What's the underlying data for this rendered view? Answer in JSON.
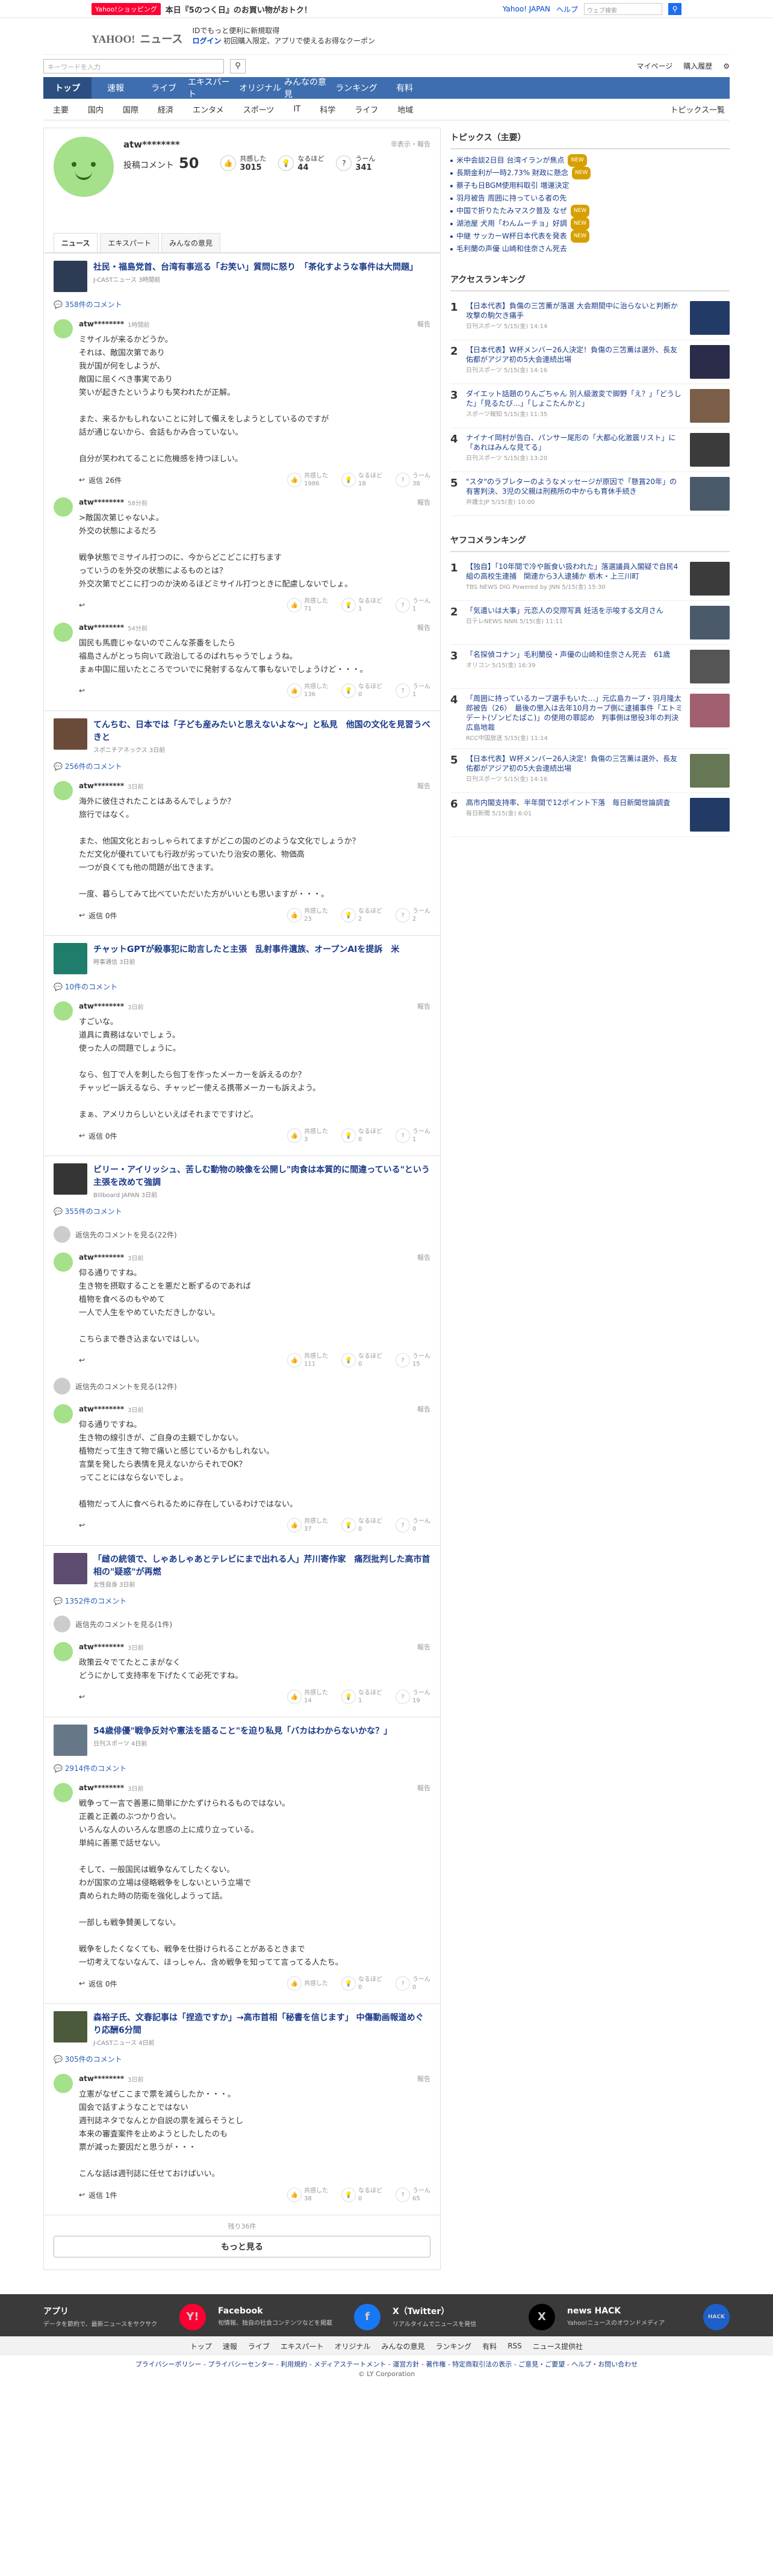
{
  "topstrip": {
    "badge": "Yahoo!ショッピング",
    "promo": "本日『5のつく日』のお買い物がおトク！",
    "right_links": [
      "Yahoo! JAPAN",
      "ヘルプ"
    ],
    "search_placeholder": "ウェブ検索"
  },
  "brand": {
    "logo": "YAHOO!",
    "sub": "ニュース",
    "promo_line1": "IDでもっと便利に新規取得",
    "promo_line2_bold": "ログイン",
    "promo_line2": "初回購入限定、アプリで使えるお得なクーポン"
  },
  "searchbar": {
    "placeholder": "キーワードを入力",
    "links": [
      "マイページ",
      "購入履歴"
    ]
  },
  "nav_main": [
    "トップ",
    "速報",
    "ライブ",
    "エキスパート",
    "オリジナル",
    "みんなの意見",
    "ランキング",
    "有料"
  ],
  "nav_sub": [
    "主要",
    "国内",
    "国際",
    "経済",
    "エンタメ",
    "スポーツ",
    "IT",
    "科学",
    "ライフ",
    "地域"
  ],
  "nav_sub_right": "トピックス一覧",
  "profile": {
    "name": "atw********",
    "hidden": "非表示・報告",
    "comments_label": "投稿コメント",
    "comments_count": "50",
    "stats": [
      {
        "label": "共感した",
        "value": "3015"
      },
      {
        "label": "なるほど",
        "value": "44"
      },
      {
        "label": "うーん",
        "value": "341"
      }
    ],
    "tabs": [
      "ニュース",
      "エキスパート",
      "みんなの意見"
    ]
  },
  "articles": [
    {
      "title": "社民・福島党首、台湾有事巡る「お笑い」質問に怒り　「茶化すような事件は大問題」",
      "source": "J-CASTニュース 3時間前",
      "count": "358件のコメント",
      "comments": [
        {
          "user": "atw********",
          "time": "1時間前",
          "text": "ミサイルが来るかどうか。\nそれは、敵国次第であり\n我が国が何をしようが、\n敵国に屈くべき事実であり\n笑いが起きたというよりも笑われたが正解。\n\nまた、来るかもしれないことに対して備えをしようとしているのですが\n話が通じないから、会話もかみ合っていない。\n\n自分が笑われてることに危機感を持つほしい。",
          "replies": "返信 26件",
          "r": [
            "1986",
            "18",
            "38"
          ]
        },
        {
          "user": "atw********",
          "time": "58分前",
          "text": ">敵国次第じゃないよ。\n外交の状態によるだろ\n\n戦争状態でミサイル打つのに、今からどこどこに打ちます\nっていうのを外交の状態によるものとは？\n外交次第でどこに打つのか決めるほどミサイル打つときに配慮しないでしょ。",
          "replies": "",
          "r": [
            "71",
            "1",
            "1"
          ]
        },
        {
          "user": "atw********",
          "time": "54分前",
          "text": "国民も馬鹿じゃないのでこんな茶番をしたら\n福島さんがとっち向いて政治してるのばれちゃうでしょうね。\nまぁ中国に屈いたところでついでに発射するなんて事もないでしょうけど・・・。",
          "replies": "",
          "r": [
            "136",
            "0",
            "1"
          ]
        }
      ]
    },
    {
      "title": "てんちむ、日本では「子ども産みたいと思えないよな〜」と私見　他国の文化を見習うべきと",
      "source": "スポニチアネックス 3日前",
      "count": "256件のコメント",
      "comments": [
        {
          "user": "atw********",
          "time": "3日前",
          "text": "海外に彼住されたことはあるんでしょうか？\n旅行ではなく。\n\nまた、他国文化とおっしゃられてますがどこの国のどのような文化でしょうか？\nただ文化が優れていても行政が劣っていたり治安の悪化、物価高\n一つが良くても他の問題が出てきます。\n\n一度、暮らしてみて比べていただいた方がいいとも思いますが・・・。",
          "replies": "返信 0件",
          "r": [
            "23",
            "2",
            "2"
          ]
        }
      ]
    },
    {
      "title": "チャットGPTが殺事犯に助言したと主張　乱射事件遺族、オープンAIを提訴　米",
      "source": "時事通信 3日前",
      "count": "10件のコメント",
      "comments": [
        {
          "user": "atw********",
          "time": "3日前",
          "text": "すごいな。\n道具に責務はないでしょう。\n使った人の問題でしょうに。\n\nなら、包丁で人を刺したら包丁を作ったメーカーを訴えるのか？\nチャッピー訴えるなら、チャッピー使える携帯メーカーも訴えよう。\n\nまぁ、アメリカらしいといえばそれまでですけど。",
          "replies": "返信 0件",
          "r": [
            "3",
            "0",
            "1"
          ]
        }
      ]
    },
    {
      "title": "ビリー・アイリッシュ、苦しむ動物の映像を公開し\"肉食は本質的に間違っている\"という主張を改めて強調",
      "source": "Billboard JAPAN 3日前",
      "count": "355件のコメント",
      "more_before": "返信先のコメントを見る(22件)",
      "comments": [
        {
          "user": "atw********",
          "time": "3日前",
          "text": "仰る通りですね。\n生き物を摂取することを悪だと断ずるのであれば\n植物を食べるのもやめて\n一人で人生をやめていただきしかない。\n\nこちらまで巻き込まないではしい。",
          "replies": "",
          "r": [
            "111",
            "0",
            "15"
          ]
        }
      ],
      "more_after": "返信先のコメントを見る(12件)",
      "comments2": [
        {
          "user": "atw********",
          "time": "3日前",
          "text": "仰る通りですね。\n生き物の線引きが、ご自身の主観でしかない。\n植物だって生きて物で痛いと感じているかもしれない。\n言葉を発したら表情を見えないからそれでOK？\nってことにはならないでしょ。\n\n植物だって人に食べられるために存在しているわけではない。",
          "replies": "",
          "r": [
            "37",
            "0",
            "0"
          ]
        }
      ]
    },
    {
      "title": "「雌の統領で、しゃあしゃあとテレビにまで出れる人」芹川寄作家　痛烈批判した高市首相の\"疑惑\"が再燃",
      "source": "女性自身 3日前",
      "count": "1352件のコメント",
      "more_before": "返信先のコメントを見る(1件)",
      "comments": [
        {
          "user": "atw********",
          "time": "3日前",
          "text": "政策云々でてたとこまがなく\nどうにかして支持率を下げたくて必死ですね。",
          "replies": "",
          "r": [
            "14",
            "1",
            "19"
          ]
        }
      ]
    },
    {
      "title": "54歳俳優\"戦争反対や憲法を語ること\"を迫り私見「バカはわからないかな？」",
      "source": "日刊スポーツ 4日前",
      "count": "2914件のコメント",
      "comments": [
        {
          "user": "atw********",
          "time": "3日前",
          "text": "戦争って一言で善悪に簡単にかたずけられるものではない。\n正義と正義のぶつかり合い。\nいろんな人のいろんな思惑の上に成り立っている。\n単純に善悪で話せない。\n\nそして、一般国民は戦争なんてしたくない。\nわが国家の立場は侵略戦争をしないという立場で\n責められた時の防衛を強化しようって話。\n\n一部しも戦争賛美してない。\n\n戦争をしたくなくても、戦争を仕掛けられることがあるときまで\n一切考えてないなんて、ほっしゃん、含め戦争を知ってて言ってる人たち。",
          "replies": "返信 0件",
          "r": [
            "",
            "0",
            "0"
          ]
        }
      ]
    },
    {
      "title": "森裕子氏、文春記事は「捏造ですか」→高市首相「秘書を信じます」 中傷動画報道めぐり応酬6分間",
      "source": "J-CASTニュース 4日前",
      "count": "305件のコメント",
      "comments": [
        {
          "user": "atw********",
          "time": "3日前",
          "text": "立憲がなぜここまで票を減らしたか・・・。\n国会で話すようなことではない\n週刊誌ネタでなんとか自説の票を減らそうとし\n本来の審査案件を止めようとしたしたのも\n票が減った要因だと思うが・・・\n\nこんな話は週刊誌に任せておけばいい。",
          "replies": "返信 1件",
          "r": [
            "38",
            "0",
            "65"
          ]
        }
      ]
    }
  ],
  "showmore": {
    "status": "残り36件",
    "button": "もっと見る"
  },
  "sidebar": {
    "topics_head": "トピックス（主要）",
    "topics": [
      {
        "t": "米中会談2日目 台湾イランが焦点",
        "b": "NEW"
      },
      {
        "t": "長期金利が一時2.73% 財政に懸念",
        "b": "NEW"
      },
      {
        "t": "蔡子も日BGM使用料取引 増運決定",
        "b": ""
      },
      {
        "t": "羽月被告 周囲に持っている者の先",
        "b": ""
      },
      {
        "t": "中国で折りたたみマスク普及 なぜ",
        "b": "NEW"
      },
      {
        "t": "湖池屋 犬用「わんムーチョ」好調",
        "b": "NEW"
      },
      {
        "t": "中継 サッカーW杯日本代表を発表",
        "b": "NEW"
      },
      {
        "t": "毛利蘭の声優 山崎和佳奈さん死去",
        "b": ""
      }
    ],
    "access_head": "アクセスランキング",
    "access": [
      {
        "t": "【日本代表】負傷の三笘薫が落選 大会期間中に治らないと判断か 攻撃の駒欠き痛手",
        "s": "日刊スポーツ 5/15(金) 14:14"
      },
      {
        "t": "【日本代表】W杯メンバー26人決定！負傷の三笘薫は選外、長友佑都がアジア初の5大会連続出場",
        "s": "日刊スポーツ 5/15(金) 14:16"
      },
      {
        "t": "ダイエット話題のりんごちゃん 別人級激変で脚野「え？」「どうした」「見るたび…」「しょこたんかと」",
        "s": "スポーツ報知 5/15(金) 11:35"
      },
      {
        "t": "ナイナイ岡村が告白、パンサー尾形の「大都心化激震リスト」に「あれはみんな見てる」",
        "s": "日刊スポーツ 5/15(金) 13:20"
      },
      {
        "t": "\"スタ\"のラブレターのようなメッセージが原因で「懸賞20年」の有害判決、3児の父親は刑務所の中からも育休手続き",
        "s": "弁護士JP 5/15(金) 10:00"
      }
    ],
    "waf_head": "ヤフコメランキング",
    "waf": [
      {
        "t": "【独自】「10年間で冷や飯食い扱われた」落選議員入閣疑で自民4組の高校生連捕　関連から3人逮捕か 栃木・上三川町",
        "s": "TBS NEWS DIG Powered by JNN 5/15(金) 15:30"
      },
      {
        "t": "「気遣いは大事」元恋人の交際写真 妊活を示唆する文月さん",
        "s": "日テレNEWS NNN 5/15(金) 11:11"
      },
      {
        "t": "「名探偵コナン」毛利蘭役・声優の山崎和佳奈さん死去　61歳",
        "s": "オリコン 5/15(金) 16:39"
      },
      {
        "t": "「周囲に持っているカーブ選手もいた…」元広島カープ・羽月隆太郎被告（26）　最後の懲入は去年10月カープ側に逮捕事件「エトミデート(ゾンビたばこ)」の使用の罪認め　判事側は懲役3年の判決　広島地裁",
        "s": "RCC中国放送 5/15(金) 11:14"
      },
      {
        "t": "【日本代表】W杯メンバー26人決定！負傷の三笘薫は選外、長友佑都がアジア初の5大会連続出場",
        "s": "日刊スポーツ 5/15(金) 14:16"
      },
      {
        "t": "高市内閣支持率、半年間で12ポイント下落　毎日新聞世論調査",
        "s": "毎日新聞 5/15(金) 6:01"
      }
    ]
  },
  "footer": {
    "cols": [
      {
        "title": "アプリ",
        "desc": "データを節約で、最新ニュースをサクサク",
        "logo": "Y!"
      },
      {
        "title": "Facebook",
        "desc": "旬情報、独自の社会コンテンツなどを掲載",
        "logo": "f"
      },
      {
        "title": "X（Twitter）",
        "desc": "リアルタイムでニュースを発信",
        "logo": "X"
      },
      {
        "title": "news HACK",
        "desc": "Yahoo!ニュースのオウンドメディア",
        "logo": "HACK"
      }
    ],
    "nav": [
      "トップ",
      "速報",
      "ライブ",
      "エキスパート",
      "オリジナル",
      "みんなの意見",
      "ランキング",
      "有料",
      "RSS",
      "ニュース提供社"
    ],
    "links": "プライバシーポリシー - プライバシーセンター - 利用規約 - メディアステートメント - 運営方針 - 著作権 - 特定商取引法の表示 - ご意見・ご要望 - ヘルプ・お問い合わせ",
    "copy": "© LY Corporation"
  },
  "colors": {
    "accent": "#3e6eb0",
    "brand": "#ff0033",
    "link": "#1a3a8a"
  }
}
